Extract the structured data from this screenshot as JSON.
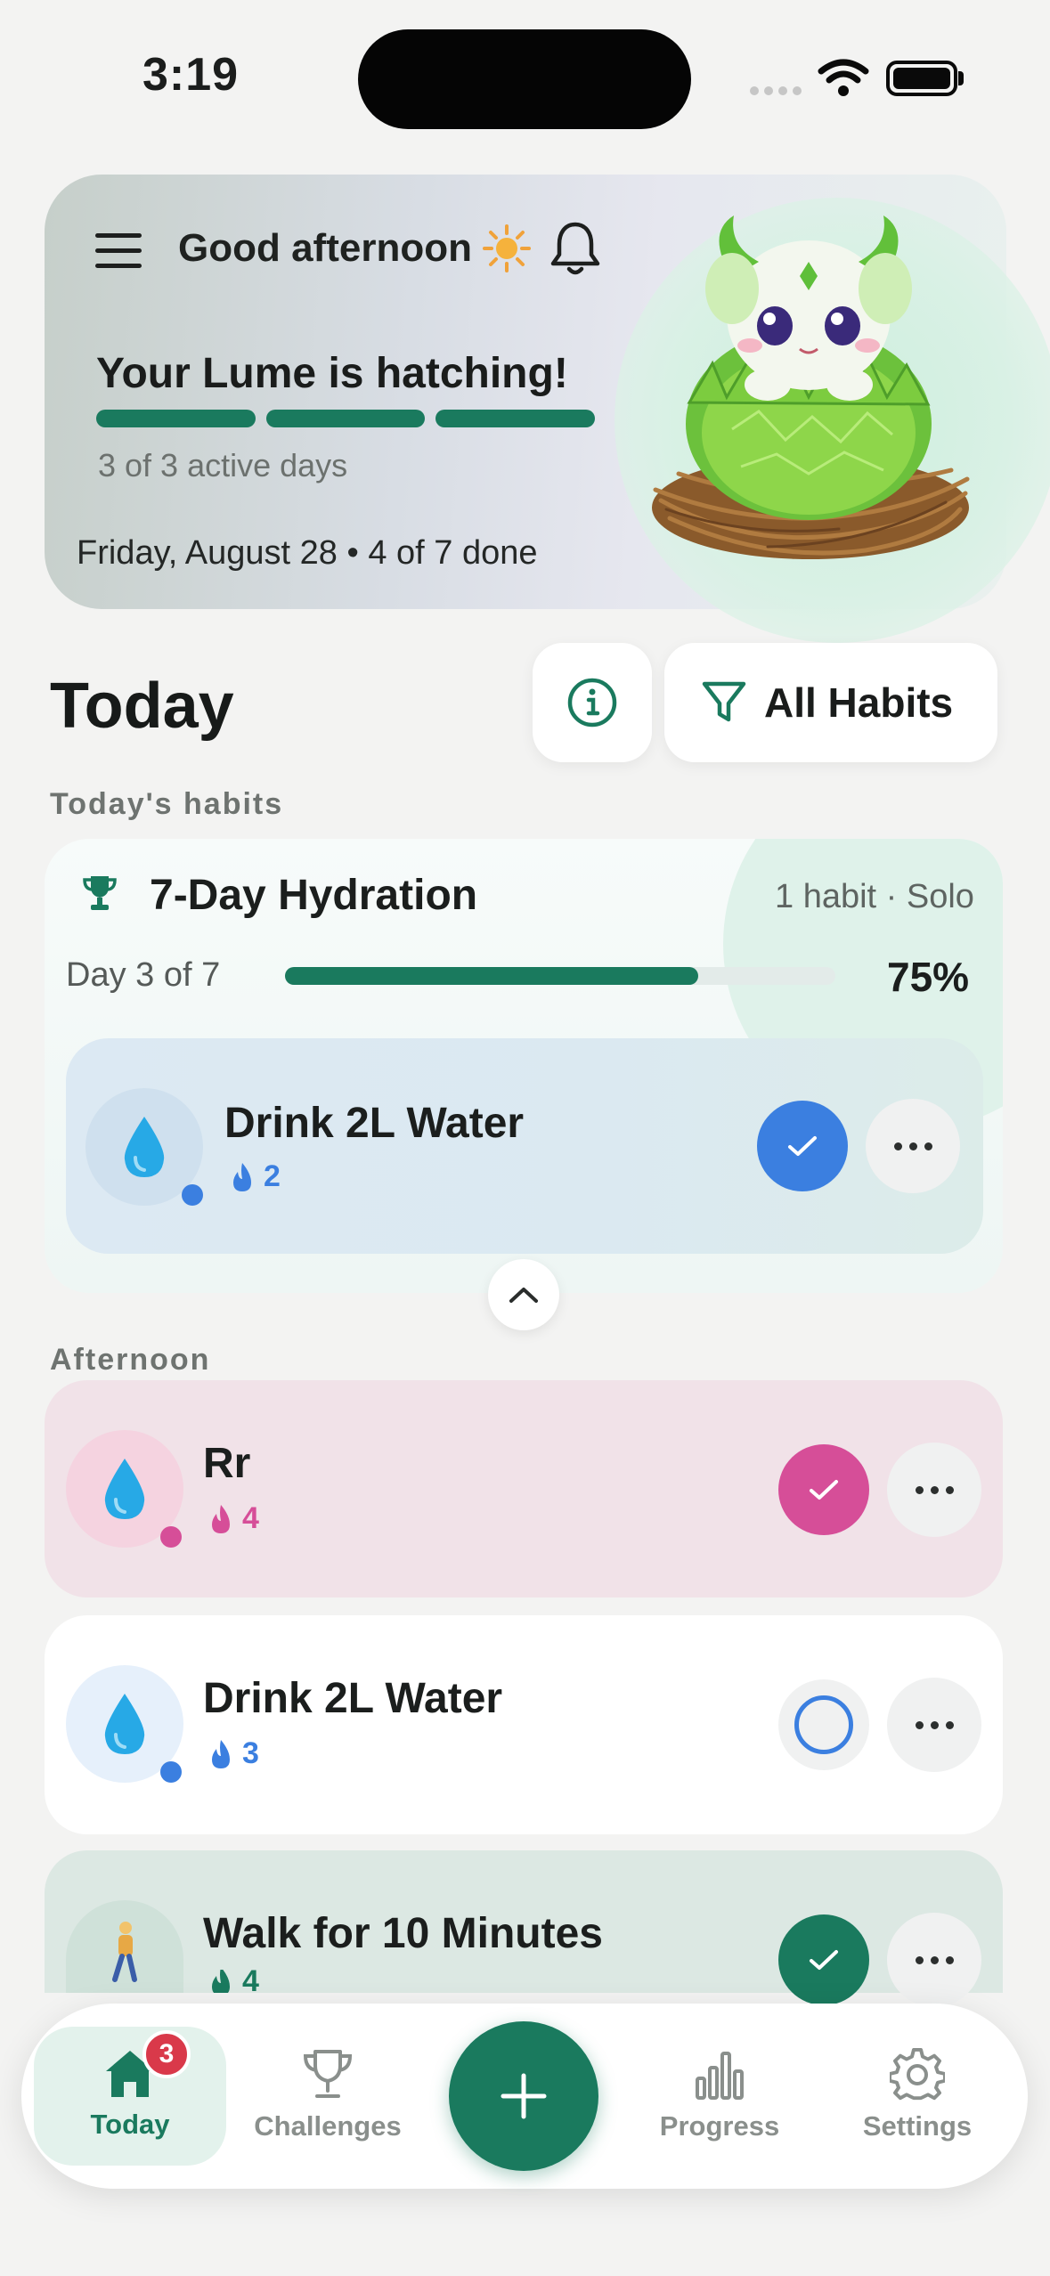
{
  "status_bar": {
    "time": "3:19"
  },
  "hero": {
    "greeting": "Good afternoon",
    "hatch_title": "Your Lume is hatching!",
    "active_days": "3 of 3 active days",
    "date_line": "Friday, August 28 • 4 of 7 done",
    "segments_filled": 3,
    "segments_total": 3
  },
  "today": {
    "title": "Today",
    "filter_label": "All Habits"
  },
  "sections": {
    "todays_habits": "Today's habits",
    "afternoon": "Afternoon"
  },
  "challenge": {
    "title": "7-Day Hydration",
    "meta": "1 habit · Solo",
    "day_label": "Day 3 of 7",
    "percent_label": "75%",
    "progress": 0.75
  },
  "habits": [
    {
      "name": "Drink 2L Water",
      "streak": "2",
      "status": "done",
      "color": "#3b7fe0"
    },
    {
      "name": "Rr",
      "streak": "4",
      "status": "done",
      "color": "#d64e98"
    },
    {
      "name": "Drink 2L Water",
      "streak": "3",
      "status": "pending",
      "color": "#3b7fe0"
    },
    {
      "name": "Walk for 10 Minutes",
      "streak": "4",
      "status": "done",
      "color": "#1a7a5e"
    }
  ],
  "nav": {
    "items": [
      {
        "label": "Today",
        "icon": "home-icon",
        "active": true
      },
      {
        "label": "Challenges",
        "icon": "trophy-icon",
        "active": false
      },
      {
        "label": "Progress",
        "icon": "bar-chart-icon",
        "active": false
      },
      {
        "label": "Settings",
        "icon": "gear-icon",
        "active": false
      }
    ],
    "badge": "3",
    "fab_icon": "plus-icon"
  },
  "colors": {
    "brand": "#1a7a5e",
    "blue": "#3b7fe0",
    "pink": "#d64e98",
    "badge": "#d9394a"
  }
}
